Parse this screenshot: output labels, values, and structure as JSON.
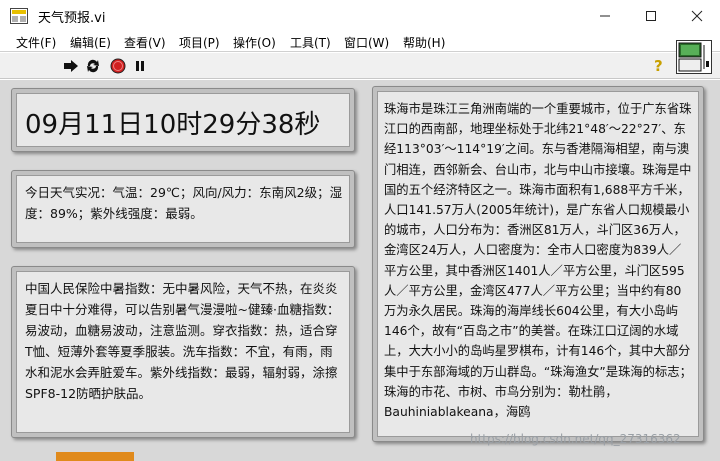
{
  "window": {
    "title": "天气预报.vi",
    "minimize_icon": "minimize-icon",
    "maximize_icon": "maximize-icon",
    "close_icon": "close-icon"
  },
  "menu": {
    "items": [
      {
        "label": "文件(F)"
      },
      {
        "label": "编辑(E)"
      },
      {
        "label": "查看(V)"
      },
      {
        "label": "项目(P)"
      },
      {
        "label": "操作(O)"
      },
      {
        "label": "工具(T)"
      },
      {
        "label": "窗口(W)"
      },
      {
        "label": "帮助(H)"
      }
    ]
  },
  "toolbar": {
    "icons": [
      "run-arrow-icon",
      "run-continuously-icon",
      "abort-icon",
      "pause-icon"
    ],
    "help_icon": "help-icon",
    "help_glyph": "?",
    "vi_icon": "vi-connector-icon"
  },
  "clock": {
    "text": "09月11日10时29分38秒"
  },
  "weather": {
    "text": "今日天气实况：气温：29℃；风向/风力：东南风2级；湿度：89%；紫外线强度：最弱。"
  },
  "indices": {
    "text": "中国人民保险中暑指数：无中暑风险，天气不热，在炎炎夏日中十分难得，可以告别暑气漫漫啦~健臻·血糖指数：易波动，血糖易波动，注意监测。穿衣指数：热，适合穿T恤、短薄外套等夏季服装。洗车指数：不宜，有雨，雨水和泥水会弄脏爱车。紫外线指数：最弱，辐射弱，涂擦SPF8-12防晒护肤品。"
  },
  "city": {
    "text": "珠海市是珠江三角洲南端的一个重要城市，位于广东省珠江口的西南部，地理坐标处于北纬21°48′～22°27′、东经113°03′～114°19′之间。东与香港隔海相望，南与澳门相连，西邻新会、台山市，北与中山市接壤。珠海是中国的五个经济特区之一。珠海市面积有1,688平方千米，人口141.57万人(2005年统计)，是广东省人口规模最小的城市，人口分布为：香洲区81万人，斗门区36万人，金湾区24万人，人口密度为：全市人口密度为839人／平方公里，其中香洲区1401人／平方公里，斗门区595人／平方公里，金湾区477人／平方公里；当中约有80万为永久居民。珠海的海岸线长604公里，有大小岛屿146个，故有“百岛之市”的美誉。在珠江口辽阔的水域上，大大小小的岛屿星罗棋布，计有146个，其中大部分集中于东部海域的万山群岛。“珠海渔女”是珠海的标志；珠海的市花、市树、市鸟分别为：勒杜鹃，Bauhiniablakeana，海鸥"
  },
  "watermark": {
    "text": "https://blog.csdn.net/qq_27316362"
  },
  "colors": {
    "panel_bg": "#d8d8d8",
    "frame_bg": "#c0c0c0",
    "text_bg": "#e8e8e8",
    "abort_red": "#d02020",
    "taskbar_accent": "#e08a1c"
  }
}
